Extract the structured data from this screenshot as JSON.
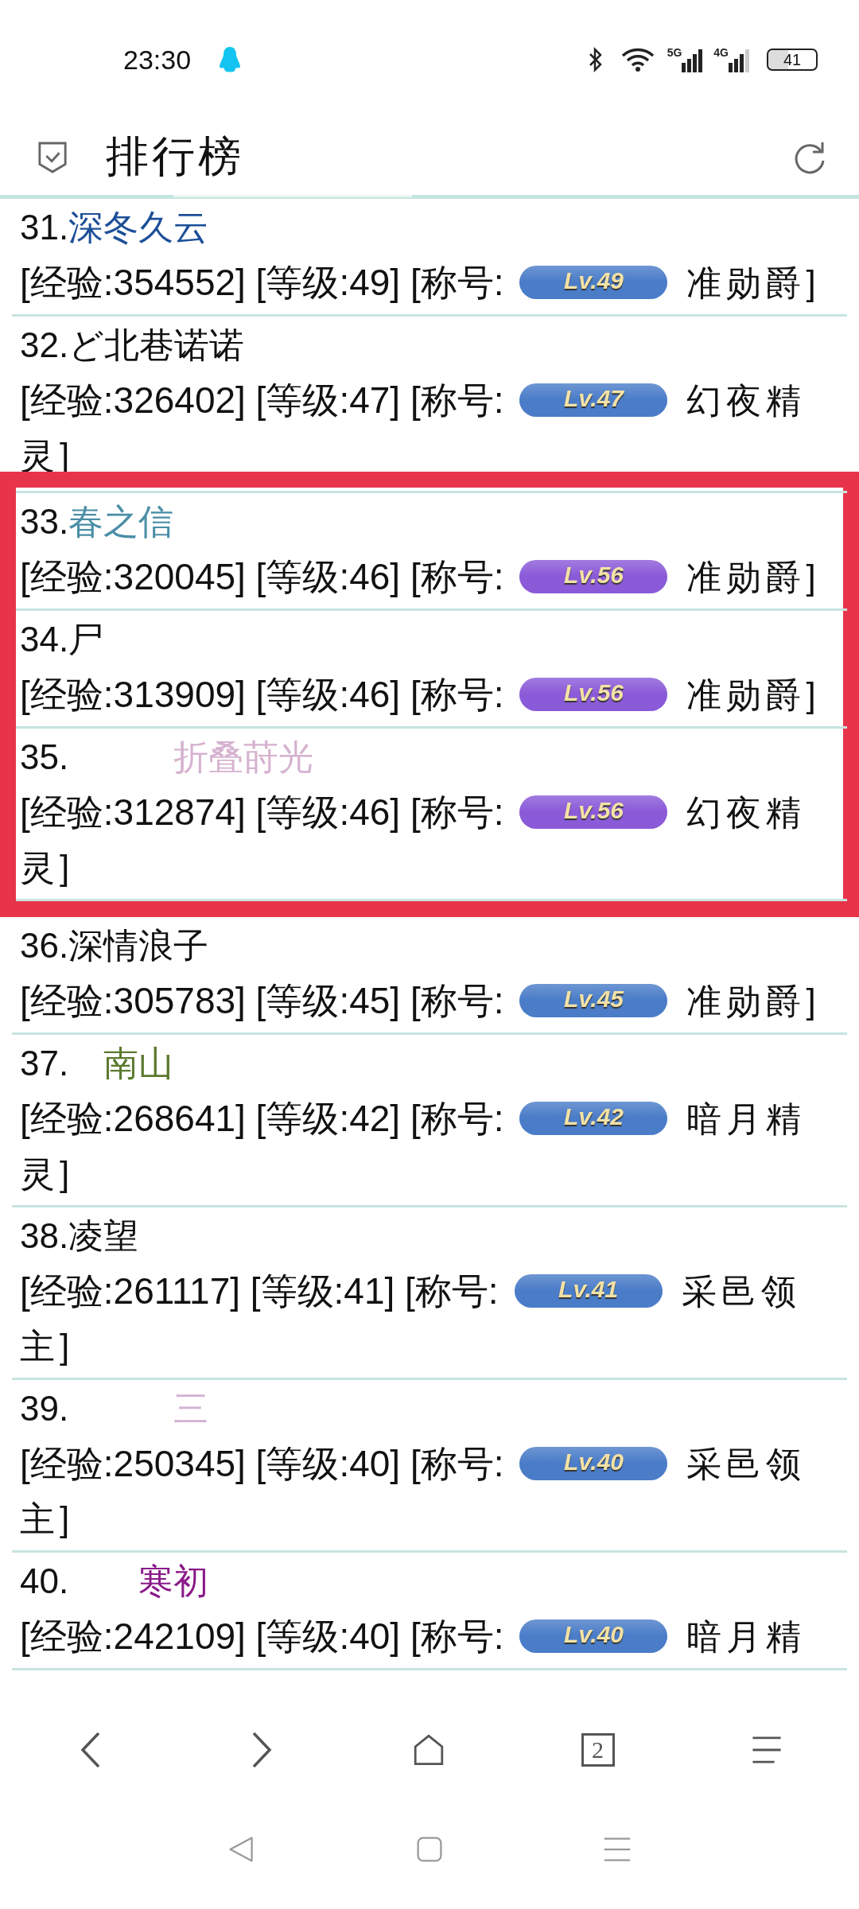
{
  "status_bar": {
    "time": "23:30",
    "signal_1": "5G",
    "signal_2": "4G",
    "battery": "41"
  },
  "header": {
    "title": "排行榜"
  },
  "rows": [
    {
      "rank": "31.",
      "name": "深冬久云",
      "color": "#1d4f98",
      "stats": "[经验:354552] [等级:49] [称号:",
      "badge": {
        "label": "Lv.49",
        "color": "#4a7cc8"
      },
      "title_lines": [
        "准勋爵]"
      ],
      "highlighted": false
    },
    {
      "rank": "32.",
      "name": "ど北巷诺诺",
      "color": "#111111",
      "stats": "[经验:326402] [等级:47] [称号:",
      "badge": {
        "label": "Lv.47",
        "color": "#4a7cc8"
      },
      "title_lines": [
        "幻夜精",
        "灵]"
      ],
      "highlighted": false
    },
    {
      "rank": "33.",
      "name": "春之信",
      "color": "#4a8ea6",
      "stats": "[经验:320045] [等级:46] [称号:",
      "badge": {
        "label": "Lv.56",
        "color": "#8a5ad8"
      },
      "title_lines": [
        "准勋爵]"
      ],
      "highlighted": true
    },
    {
      "rank": "34.",
      "name": "尸",
      "color": "#111111",
      "stats": "[经验:313909] [等级:46] [称号:",
      "badge": {
        "label": "Lv.56",
        "color": "#8a5ad8"
      },
      "title_lines": [
        "准勋爵]"
      ],
      "highlighted": true
    },
    {
      "rank": "35.",
      "name": "　　　折叠莳光",
      "color": "#d6b2cf",
      "stats": "[经验:312874] [等级:46] [称号:",
      "badge": {
        "label": "Lv.56",
        "color": "#8a5ad8"
      },
      "title_lines": [
        "幻夜精",
        "灵]"
      ],
      "highlighted": true
    },
    {
      "rank": "36.",
      "name": "深情浪子",
      "color": "#111111",
      "stats": "[经验:305783] [等级:45] [称号:",
      "badge": {
        "label": "Lv.45",
        "color": "#4a7cc8"
      },
      "title_lines": [
        "准勋爵]"
      ],
      "highlighted": false
    },
    {
      "rank": "37.",
      "name": "　南山",
      "color": "#5b7a2e",
      "stats": "[经验:268641] [等级:42] [称号:",
      "badge": {
        "label": "Lv.42",
        "color": "#4a7cc8"
      },
      "title_lines": [
        "暗月精",
        "灵]"
      ],
      "highlighted": false
    },
    {
      "rank": "38.",
      "name": "凌望",
      "color": "#111111",
      "stats": "[经验:261117] [等级:41] [称号:",
      "badge": {
        "label": "Lv.41",
        "color": "#4a7cc8"
      },
      "title_lines": [
        "采邑领",
        "主]"
      ],
      "highlighted": false
    },
    {
      "rank": "39.",
      "name": "　　　三",
      "color": "#d2b2d2",
      "stats": "[经验:250345] [等级:40] [称号:",
      "badge": {
        "label": "Lv.40",
        "color": "#4a7cc8"
      },
      "title_lines": [
        "采邑领",
        "主]"
      ],
      "highlighted": false
    },
    {
      "rank": "40.",
      "name": "　　寒初",
      "color": "#8a1a8a",
      "stats": "[经验:242109] [等级:40] [称号:",
      "badge": {
        "label": "Lv.40",
        "color": "#4a7cc8"
      },
      "title_lines": [
        "暗月精"
      ],
      "highlighted": false
    }
  ],
  "browser_bar": {
    "tab_count": "2"
  }
}
